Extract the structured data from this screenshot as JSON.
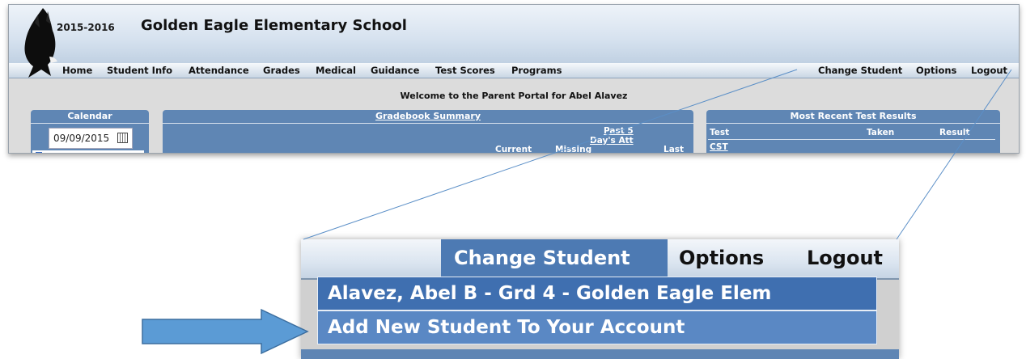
{
  "portal": {
    "year": "2015-2016",
    "school_name": "Golden Eagle Elementary School",
    "nav_left": [
      "Home",
      "Student Info",
      "Attendance",
      "Grades",
      "Medical",
      "Guidance",
      "Test Scores",
      "Programs"
    ],
    "nav_right": [
      "Change Student",
      "Options",
      "Logout"
    ],
    "welcome": "Welcome to the Parent Portal for Abel Alavez",
    "calendar": {
      "title": "Calendar",
      "date": "09/09/2015"
    },
    "gradebook": {
      "title": "Gradebook Summary",
      "headers": {
        "past": "Past 5",
        "days_att": "Day's Att",
        "current": "Current",
        "missing": "Missing",
        "last": "Last"
      }
    },
    "tests": {
      "title": "Most Recent Test Results",
      "headers": {
        "test": "Test",
        "taken": "Taken",
        "result": "Result"
      },
      "first_row": "CST"
    }
  },
  "zoom": {
    "nav": [
      "Change Student",
      "Options",
      "Logout"
    ],
    "dropdown": [
      "Alavez, Abel B - Grd 4 - Golden Eagle Elem",
      "Add New Student To Your Account"
    ]
  },
  "colors": {
    "panel_blue": "#5f86b4",
    "menu_blue": "#3f6fb0",
    "arrow_blue": "#5b9bd5"
  }
}
